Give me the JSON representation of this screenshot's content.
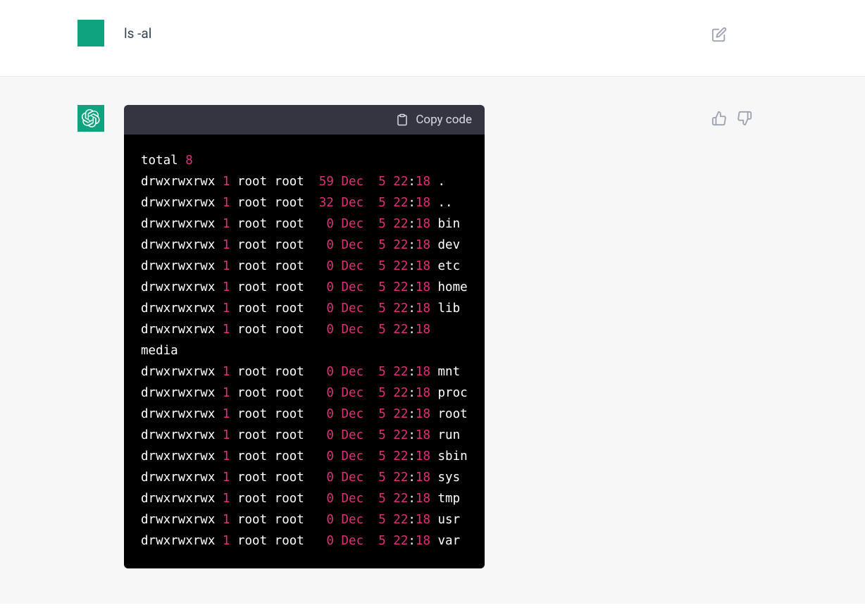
{
  "user": {
    "message": "ls -al"
  },
  "assistant": {
    "copy_label": "Copy code",
    "code": {
      "total_label": "total ",
      "total_value": "8",
      "rows": [
        {
          "perms": "drwxrwxrwx ",
          "links": "1",
          "owner": " root root  ",
          "size": "59",
          "month": " Dec  ",
          "day": "5",
          "sp": " ",
          "hour": "22",
          "colon": ":",
          "min": "18",
          "name": " ."
        },
        {
          "perms": "drwxrwxrwx ",
          "links": "1",
          "owner": " root root  ",
          "size": "32",
          "month": " Dec  ",
          "day": "5",
          "sp": " ",
          "hour": "22",
          "colon": ":",
          "min": "18",
          "name": " .."
        },
        {
          "perms": "drwxrwxrwx ",
          "links": "1",
          "owner": " root root   ",
          "size": "0",
          "month": " Dec  ",
          "day": "5",
          "sp": " ",
          "hour": "22",
          "colon": ":",
          "min": "18",
          "name": " bin"
        },
        {
          "perms": "drwxrwxrwx ",
          "links": "1",
          "owner": " root root   ",
          "size": "0",
          "month": " Dec  ",
          "day": "5",
          "sp": " ",
          "hour": "22",
          "colon": ":",
          "min": "18",
          "name": " dev"
        },
        {
          "perms": "drwxrwxrwx ",
          "links": "1",
          "owner": " root root   ",
          "size": "0",
          "month": " Dec  ",
          "day": "5",
          "sp": " ",
          "hour": "22",
          "colon": ":",
          "min": "18",
          "name": " etc"
        },
        {
          "perms": "drwxrwxrwx ",
          "links": "1",
          "owner": " root root   ",
          "size": "0",
          "month": " Dec  ",
          "day": "5",
          "sp": " ",
          "hour": "22",
          "colon": ":",
          "min": "18",
          "name": " home"
        },
        {
          "perms": "drwxrwxrwx ",
          "links": "1",
          "owner": " root root   ",
          "size": "0",
          "month": " Dec  ",
          "day": "5",
          "sp": " ",
          "hour": "22",
          "colon": ":",
          "min": "18",
          "name": " lib"
        },
        {
          "perms": "drwxrwxrwx ",
          "links": "1",
          "owner": " root root   ",
          "size": "0",
          "month": " Dec  ",
          "day": "5",
          "sp": " ",
          "hour": "22",
          "colon": ":",
          "min": "18",
          "name": " \nmedia"
        },
        {
          "perms": "drwxrwxrwx ",
          "links": "1",
          "owner": " root root   ",
          "size": "0",
          "month": " Dec  ",
          "day": "5",
          "sp": " ",
          "hour": "22",
          "colon": ":",
          "min": "18",
          "name": " mnt"
        },
        {
          "perms": "drwxrwxrwx ",
          "links": "1",
          "owner": " root root   ",
          "size": "0",
          "month": " Dec  ",
          "day": "5",
          "sp": " ",
          "hour": "22",
          "colon": ":",
          "min": "18",
          "name": " proc"
        },
        {
          "perms": "drwxrwxrwx ",
          "links": "1",
          "owner": " root root   ",
          "size": "0",
          "month": " Dec  ",
          "day": "5",
          "sp": " ",
          "hour": "22",
          "colon": ":",
          "min": "18",
          "name": " root"
        },
        {
          "perms": "drwxrwxrwx ",
          "links": "1",
          "owner": " root root   ",
          "size": "0",
          "month": " Dec  ",
          "day": "5",
          "sp": " ",
          "hour": "22",
          "colon": ":",
          "min": "18",
          "name": " run"
        },
        {
          "perms": "drwxrwxrwx ",
          "links": "1",
          "owner": " root root   ",
          "size": "0",
          "month": " Dec  ",
          "day": "5",
          "sp": " ",
          "hour": "22",
          "colon": ":",
          "min": "18",
          "name": " sbin"
        },
        {
          "perms": "drwxrwxrwx ",
          "links": "1",
          "owner": " root root   ",
          "size": "0",
          "month": " Dec  ",
          "day": "5",
          "sp": " ",
          "hour": "22",
          "colon": ":",
          "min": "18",
          "name": " sys"
        },
        {
          "perms": "drwxrwxrwx ",
          "links": "1",
          "owner": " root root   ",
          "size": "0",
          "month": " Dec  ",
          "day": "5",
          "sp": " ",
          "hour": "22",
          "colon": ":",
          "min": "18",
          "name": " tmp"
        },
        {
          "perms": "drwxrwxrwx ",
          "links": "1",
          "owner": " root root   ",
          "size": "0",
          "month": " Dec  ",
          "day": "5",
          "sp": " ",
          "hour": "22",
          "colon": ":",
          "min": "18",
          "name": " usr"
        },
        {
          "perms": "drwxrwxrwx ",
          "links": "1",
          "owner": " root root   ",
          "size": "0",
          "month": " Dec  ",
          "day": "5",
          "sp": " ",
          "hour": "22",
          "colon": ":",
          "min": "18",
          "name": " var"
        }
      ]
    }
  }
}
